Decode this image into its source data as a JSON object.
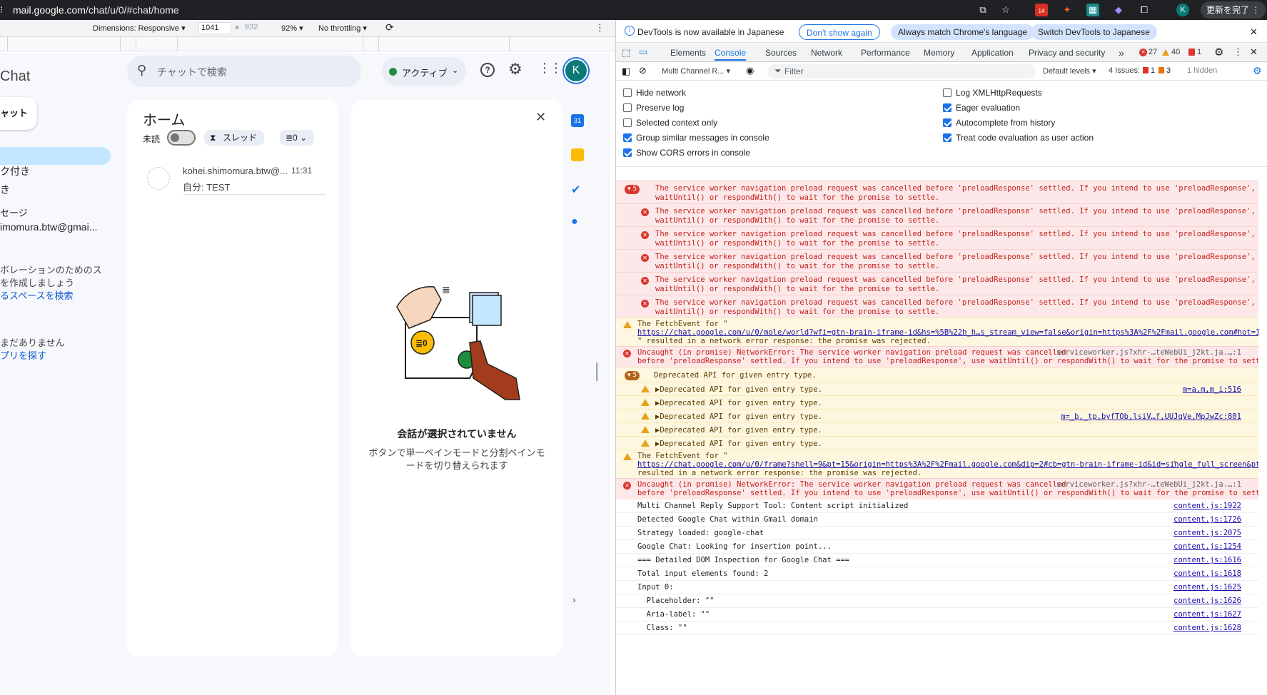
{
  "browser": {
    "url_host": "mail.google.com",
    "url_path": "/chat/u/0/#chat/home",
    "badge_count": "14",
    "profile_initial": "K",
    "update_label": "更新を完了"
  },
  "devicebar": {
    "dimensions_label": "Dimensions: Responsive",
    "width": "1041",
    "times": "×",
    "height": "932",
    "zoom": "92%",
    "throttle": "No throttling"
  },
  "chat": {
    "app_title": "Chat",
    "new_chat_label": "ャット",
    "search_placeholder": "チャットで検索",
    "status_label": "アクティブ",
    "profile_initial": "K",
    "nav_items": [
      "ク付き",
      "き"
    ],
    "section_label": "セージ",
    "dm_item": "imomura.btw@gmai...",
    "space_promo_1": "ボレーションのためのス",
    "space_promo_2": "を作成しましょう",
    "space_link": "るスペースを検索",
    "apps_empty": "まだありません",
    "apps_link": "プリを探す",
    "home": {
      "title": "ホーム",
      "unread_label": "未読",
      "thread_label": "スレッド",
      "filter_label": "≣0",
      "conversation": {
        "name": "kohei.shimomura.btw@...",
        "time": "11:31",
        "preview": "自分: TEST"
      }
    },
    "empty": {
      "title": "会話が選択されていません",
      "desc_1": "ボタンで単一ペインモードと分割ペインモ",
      "desc_2": "ードを切り替えられます",
      "badge": "≣0"
    }
  },
  "devtools": {
    "info_text": "DevTools is now available in Japanese",
    "btn_dont_show": "Don't show again",
    "btn_match": "Always match Chrome's language",
    "btn_switch": "Switch DevTools to Japanese",
    "tabs": [
      "Elements",
      "Console",
      "Sources",
      "Network",
      "Performance",
      "Memory",
      "Application",
      "Privacy and security"
    ],
    "errors_count": "27",
    "warnings_count": "40",
    "issues_count_small": "1",
    "context": "Multi Channel R...",
    "filter_placeholder": "Filter",
    "levels": "Default levels",
    "issues_label": "4 Issues:",
    "issues_err": "1",
    "issues_warn": "3",
    "hidden": "1 hidden",
    "settings_left": [
      {
        "label": "Hide network",
        "checked": false
      },
      {
        "label": "Preserve log",
        "checked": false
      },
      {
        "label": "Selected context only",
        "checked": false
      },
      {
        "label": "Group similar messages in console",
        "checked": true
      },
      {
        "label": "Show CORS errors in console",
        "checked": true
      }
    ],
    "settings_right": [
      {
        "label": "Log XMLHttpRequests",
        "checked": false
      },
      {
        "label": "Eager evaluation",
        "checked": true
      },
      {
        "label": "Autocomplete from history",
        "checked": true
      },
      {
        "label": "Treat code evaluation as user action",
        "checked": true
      }
    ],
    "console": {
      "sw_line1": "The service worker navigation preload request was cancelled before 'preloadResponse' settled. If you intend to use 'preloadResponse', use",
      "sw_line2": "waitUntil() or respondWith() to wait for the promise to settle.",
      "group_count_1": "5",
      "fetch_1_a": "The FetchEvent for \"",
      "fetch_1_url": "https://chat.google.com/u/0/mole/world?wfi=gtn-brain-iframe-id&hs=%5B%22h_h…s_stream_view=false&origin=https%3A%2F%2Fmail.google.com#hot=17…",
      "fetch_b": "\" resulted in a network error response: the promise was rejected.",
      "uncaught_1": "Uncaught (in promise) NetworkError: The service worker navigation preload request was cancelled",
      "uncaught_2": "before 'preloadResponse' settled. If you intend to use 'preloadResponse', use waitUntil() or respondWith() to wait for the promise to settle.",
      "uncaught_src": "serviceworker.js?xhr-…teWebUi_j2kt.ja.…:1",
      "group_count_2": "5",
      "deprecated": "Deprecated API for given entry type.",
      "dep_items": [
        "▶Deprecated API for given entry type.",
        "▶Deprecated API for given entry type.",
        "▶Deprecated API for given entry type.",
        "▶Deprecated API for given entry type.",
        "▶Deprecated API for given entry type."
      ],
      "dep_src_1": "m=a,m,m_i:516",
      "dep_src_3": "m=_b,_tp,byfTOb,lsiV…f,UUJqVe,MpJwZc:801",
      "fetch_2_a": "The FetchEvent for \"",
      "fetch_2_url": "https://chat.google.com/u/0/frame?shell=9&pt=15&origin=https%3A%2F%2Fmail.google.com&dip=2#cb=gtn-brain-iframe-id&id=single_full_screen&pt=15",
      "fetch_2_end": "\"",
      "fetch_2_b": "resulted in a network error response: the promise was rejected.",
      "logs": [
        {
          "text": "Multi Channel Reply Support Tool: Content script initialized",
          "src": "content.js:1922"
        },
        {
          "text": "Detected Google Chat within Gmail domain",
          "src": "content.js:1726"
        },
        {
          "text": "Strategy loaded: google-chat",
          "src": "content.js:2075"
        },
        {
          "text": "Google Chat: Looking for insertion point...",
          "src": "content.js:1254"
        },
        {
          "text": "=== Detailed DOM Inspection for Google Chat ===",
          "src": "content.js:1616"
        },
        {
          "text": "Total input elements found: 2",
          "src": "content.js:1618"
        },
        {
          "text": "Input 0:",
          "src": "content.js:1625"
        },
        {
          "text": "  Placeholder: \"\"",
          "src": "content.js:1626"
        },
        {
          "text": "  Aria-label: \"\"",
          "src": "content.js:1627"
        },
        {
          "text": "  Class: \"\"",
          "src": "content.js:1628"
        }
      ]
    }
  },
  "colors": {
    "accent": "#1a73e8",
    "error_bg": "#fce8e8",
    "warn_bg": "#fef7e0",
    "active_green": "#1e8e3e",
    "avatar_teal": "#0b7a75"
  }
}
